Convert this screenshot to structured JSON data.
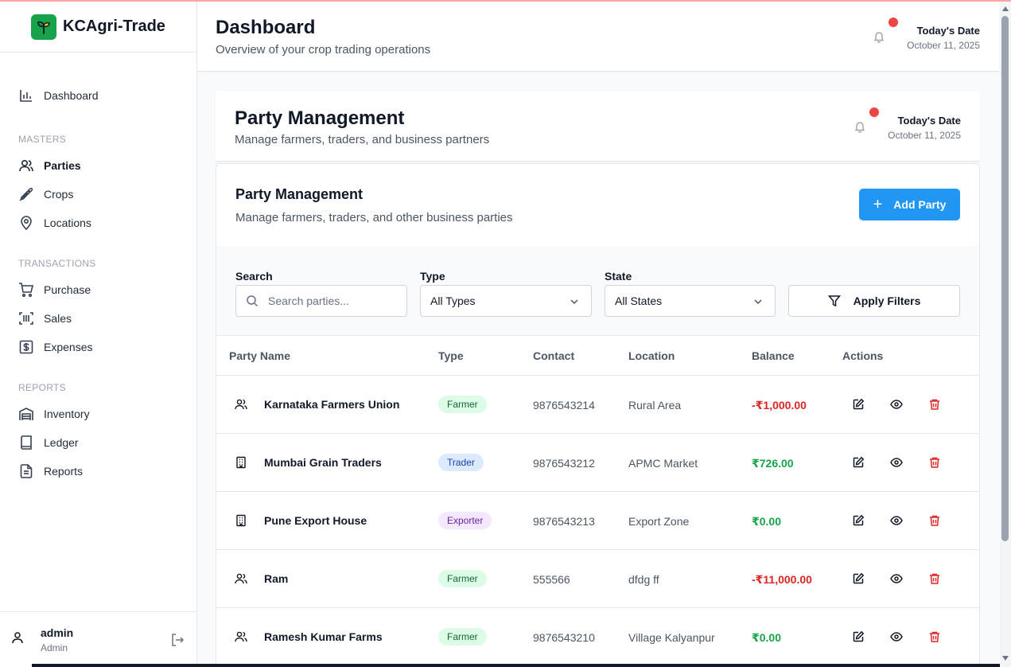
{
  "app": {
    "name": "KCAgri-Trade",
    "brand_color": "#16a34a",
    "accent": "#2196f3"
  },
  "sidebar": {
    "dashboard": {
      "label": "Dashboard",
      "icon": "bar-chart-icon"
    },
    "sections": [
      {
        "title": "MASTERS",
        "items": [
          {
            "label": "Parties",
            "icon": "users-icon",
            "active": true
          },
          {
            "label": "Crops",
            "icon": "wheat-icon"
          },
          {
            "label": "Locations",
            "icon": "map-pin-icon"
          }
        ]
      },
      {
        "title": "TRANSACTIONS",
        "items": [
          {
            "label": "Purchase",
            "icon": "cart-icon"
          },
          {
            "label": "Sales",
            "icon": "barcode-scan-icon"
          },
          {
            "label": "Expenses",
            "icon": "dollar-square-icon"
          }
        ]
      },
      {
        "title": "REPORTS",
        "items": [
          {
            "label": "Inventory",
            "icon": "warehouse-icon"
          },
          {
            "label": "Ledger",
            "icon": "book-icon"
          },
          {
            "label": "Reports",
            "icon": "file-text-icon"
          }
        ]
      }
    ],
    "user": {
      "name": "admin",
      "role": "Admin"
    }
  },
  "header": {
    "title": "Dashboard",
    "subtitle": "Overview of your crop trading operations",
    "date_label": "Today's Date",
    "date_value": "October 11, 2025"
  },
  "inner_header": {
    "title": "Party Management",
    "subtitle": "Manage farmers, traders, and business partners",
    "date_label": "Today's Date",
    "date_value": "October 11, 2025"
  },
  "card": {
    "title": "Party Management",
    "subtitle": "Manage farmers, traders, and other business parties",
    "add_button": "Add Party"
  },
  "filters": {
    "search_label": "Search",
    "search_placeholder": "Search parties...",
    "type_label": "Type",
    "type_value": "All Types",
    "state_label": "State",
    "state_value": "All States",
    "apply_button": "Apply Filters"
  },
  "table": {
    "columns": [
      "Party Name",
      "Type",
      "Contact",
      "Location",
      "Balance",
      "Actions"
    ],
    "rows": [
      {
        "name": "Karnataka Farmers Union",
        "icon": "users-icon",
        "type": "Farmer",
        "contact": "9876543214",
        "location": "Rural Area",
        "balance": "-₹1,000.00",
        "balance_sign": "neg"
      },
      {
        "name": "Mumbai Grain Traders",
        "icon": "building-icon",
        "type": "Trader",
        "contact": "9876543212",
        "location": "APMC Market",
        "balance": "₹726.00",
        "balance_sign": "pos"
      },
      {
        "name": "Pune Export House",
        "icon": "building-icon",
        "type": "Exporter",
        "contact": "9876543213",
        "location": "Export Zone",
        "balance": "₹0.00",
        "balance_sign": "pos"
      },
      {
        "name": "Ram",
        "icon": "users-icon",
        "type": "Farmer",
        "contact": "555566",
        "location": "dfdg ff",
        "balance": "-₹11,000.00",
        "balance_sign": "neg"
      },
      {
        "name": "Ramesh Kumar Farms",
        "icon": "users-icon",
        "type": "Farmer",
        "contact": "9876543210",
        "location": "Village Kalyanpur",
        "balance": "₹0.00",
        "balance_sign": "pos"
      }
    ]
  }
}
